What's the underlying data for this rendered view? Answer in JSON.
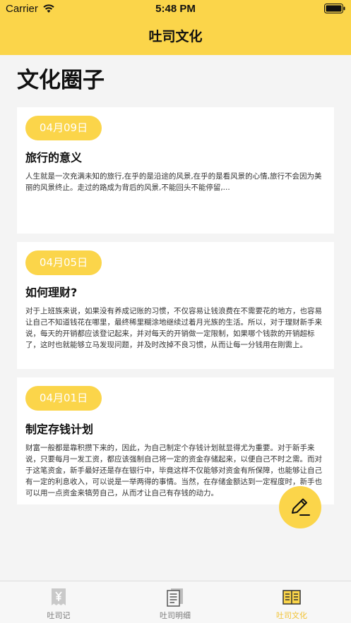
{
  "status_bar": {
    "carrier": "Carrier",
    "time": "5:48 PM"
  },
  "nav": {
    "title": "吐司文化"
  },
  "page": {
    "title": "文化圈子"
  },
  "cards": [
    {
      "date": "04月09日",
      "title": "旅行的意义",
      "body": "人生就是一次充满未知的旅行,在乎的是沿途的风景,在乎的是看风景的心情,旅行不会因为美丽的风景终止。走过的路成为背后的风景,不能回头不能停留,..."
    },
    {
      "date": "04月05日",
      "title": "如何理财?",
      "body": "对于上班族来说，如果没有养成记账的习惯，不仅容易让钱浪费在不需要花的地方，也容易让自己不知道钱花在哪里，最终稀里糊涂地继续过着月光族的生活。所以，对于理财新手来说，每天的开销都应该登记起来，并对每天的开销做一定限制，如果哪个钱款的开销超标了，这时也就能够立马发现问题，并及时改掉不良习惯，从而让每一分钱用在刚需上。"
    },
    {
      "date": "04月01日",
      "title": "制定存钱计划",
      "body": "财富一般都是靠积攒下来的，因此，为自己制定个存钱计划就显得尤为重要。对于新手来说，只要每月一发工资，都应该强制自己将一定的资金存储起来，以便自己不时之需。而对于这笔资金，新手最好还是存在银行中，毕竟这样不仅能够对资金有所保障，也能够让自己有一定的利息收入，可以说是一举两得的事情。当然，在存储金额达到一定程度时，新手也可以用一点资金来犒劳自己，从而才让自己有存钱的动力。"
    }
  ],
  "fab": {
    "icon": "edit-pen-icon"
  },
  "tabbar": {
    "tabs": [
      {
        "label": "吐司记",
        "icon": "yen-receipt-icon",
        "active": false
      },
      {
        "label": "吐司明细",
        "icon": "document-list-icon",
        "active": false
      },
      {
        "label": "吐司文化",
        "icon": "open-book-icon",
        "active": true
      }
    ]
  },
  "colors": {
    "accent": "#fbd54a",
    "active_tab": "#f1c232",
    "background": "#f4f4f4"
  }
}
